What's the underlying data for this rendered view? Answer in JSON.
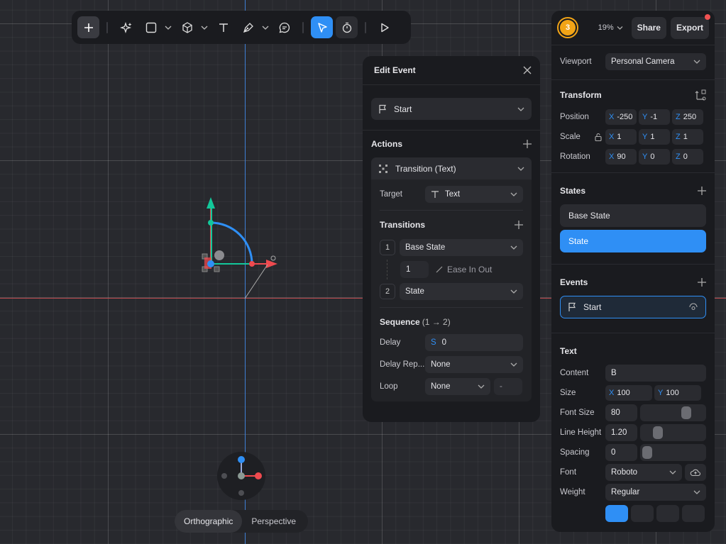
{
  "toolbar": {
    "tools": [
      "add",
      "ai-sparkle",
      "rectangle",
      "cube",
      "text",
      "pen",
      "comment",
      "select",
      "timer",
      "play"
    ]
  },
  "edit_event": {
    "title": "Edit Event",
    "trigger": "Start",
    "actions_title": "Actions",
    "action": "Transition (Text)",
    "target_label": "Target",
    "target_value": "Text",
    "transitions_title": "Transitions",
    "transitions": [
      {
        "index": "1",
        "state": "Base State",
        "duration": "1",
        "easing": "Ease In Out"
      },
      {
        "index": "2",
        "state": "State"
      }
    ],
    "sequence_title": "Sequence",
    "sequence_range": "(1 → 2)",
    "delay_label": "Delay",
    "delay_prefix": "S",
    "delay_value": "0",
    "delay_repeat_label": "Delay Rep...",
    "delay_repeat_value": "None",
    "loop_label": "Loop",
    "loop_value": "None",
    "loop_count": "-"
  },
  "right_panel": {
    "avatar": "3",
    "zoom": "19%",
    "share": "Share",
    "export": "Export",
    "viewport_label": "Viewport",
    "viewport_value": "Personal Camera",
    "transform_title": "Transform",
    "position_label": "Position",
    "position": {
      "x": "-250",
      "y": "-1",
      "z": "250"
    },
    "scale_label": "Scale",
    "scale": {
      "x": "1",
      "y": "1",
      "z": "1"
    },
    "rotation_label": "Rotation",
    "rotation": {
      "x": "90",
      "y": "0",
      "z": "0"
    },
    "states_title": "States",
    "states": [
      "Base State",
      "State"
    ],
    "events_title": "Events",
    "event": "Start",
    "text_title": "Text",
    "content_label": "Content",
    "content_value": "B",
    "size_label": "Size",
    "size": {
      "x": "100",
      "y": "100"
    },
    "font_size_label": "Font Size",
    "font_size": "80",
    "font_size_level": 0.75,
    "line_height_label": "Line Height",
    "line_height": "1.20",
    "line_height_level": 0.2,
    "spacing_label": "Spacing",
    "spacing": "0",
    "spacing_level": 0.0,
    "font_label": "Font",
    "font_value": "Roboto",
    "weight_label": "Weight",
    "weight_value": "Regular",
    "axis_letters": {
      "x": "X",
      "y": "Y",
      "z": "Z"
    }
  },
  "view_switch": {
    "options": [
      "Orthographic",
      "Perspective"
    ],
    "selected": "Orthographic"
  },
  "colors": {
    "accent": "#2f8ff5",
    "x_axis": "#ef4a4f",
    "y_axis": "#13c79a",
    "z_axis": "#2f8ff5",
    "avatar": "#f2a416"
  }
}
